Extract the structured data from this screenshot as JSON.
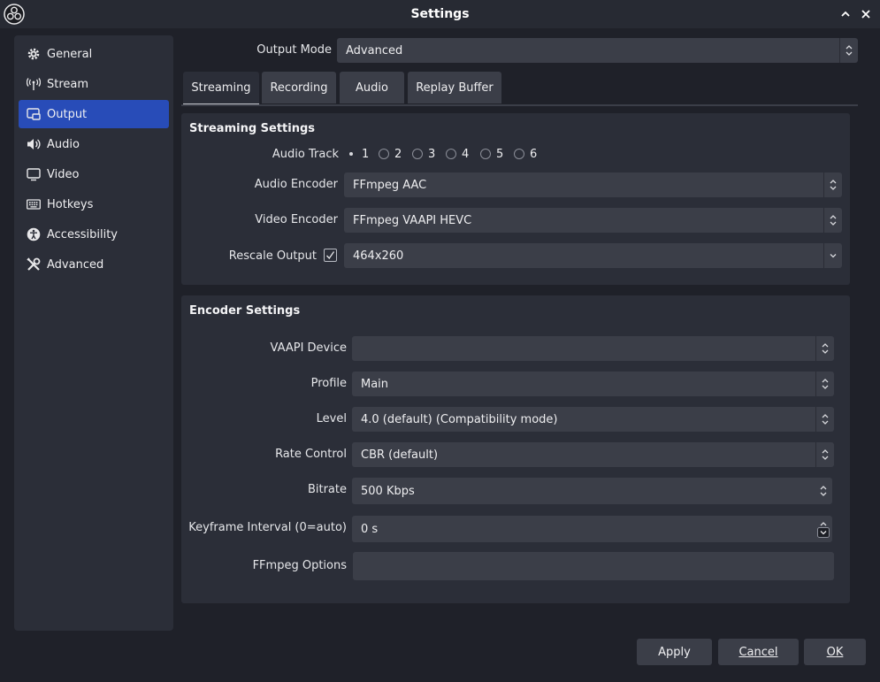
{
  "window": {
    "title": "Settings"
  },
  "sidebar": {
    "items": [
      {
        "label": "General",
        "icon": "gear-icon"
      },
      {
        "label": "Stream",
        "icon": "antenna-icon"
      },
      {
        "label": "Output",
        "icon": "output-icon",
        "active": true
      },
      {
        "label": "Audio",
        "icon": "speaker-icon"
      },
      {
        "label": "Video",
        "icon": "monitor-icon"
      },
      {
        "label": "Hotkeys",
        "icon": "keyboard-icon"
      },
      {
        "label": "Accessibility",
        "icon": "accessibility-icon"
      },
      {
        "label": "Advanced",
        "icon": "tools-icon"
      }
    ]
  },
  "output_mode": {
    "label": "Output Mode",
    "value": "Advanced"
  },
  "tabs": [
    {
      "label": "Streaming",
      "active": true
    },
    {
      "label": "Recording"
    },
    {
      "label": "Audio"
    },
    {
      "label": "Replay Buffer"
    }
  ],
  "streaming_settings": {
    "title": "Streaming Settings",
    "audio_track": {
      "label": "Audio Track",
      "options": [
        "1",
        "2",
        "3",
        "4",
        "5",
        "6"
      ],
      "selected": "1"
    },
    "audio_encoder": {
      "label": "Audio Encoder",
      "value": "FFmpeg AAC"
    },
    "video_encoder": {
      "label": "Video Encoder",
      "value": "FFmpeg VAAPI HEVC"
    },
    "rescale_output": {
      "label": "Rescale Output",
      "checked": true,
      "value": "464x260"
    }
  },
  "encoder_settings": {
    "title": "Encoder Settings",
    "vaapi_device": {
      "label": "VAAPI Device",
      "value": ""
    },
    "profile": {
      "label": "Profile",
      "value": "Main"
    },
    "level": {
      "label": "Level",
      "value": "4.0 (default) (Compatibility mode)"
    },
    "rate_control": {
      "label": "Rate Control",
      "value": "CBR (default)"
    },
    "bitrate": {
      "label": "Bitrate",
      "value": "500 Kbps"
    },
    "keyframe_interval": {
      "label": "Keyframe Interval (0=auto)",
      "value": "0 s"
    },
    "ffmpeg_options": {
      "label": "FFmpeg Options",
      "value": ""
    }
  },
  "buttons": {
    "apply": "Apply",
    "cancel": "Cancel",
    "ok": "OK"
  },
  "colors": {
    "accent": "#284cb8",
    "panel": "#2b2e38",
    "control": "#3b3e48",
    "background": "#1f2129"
  }
}
